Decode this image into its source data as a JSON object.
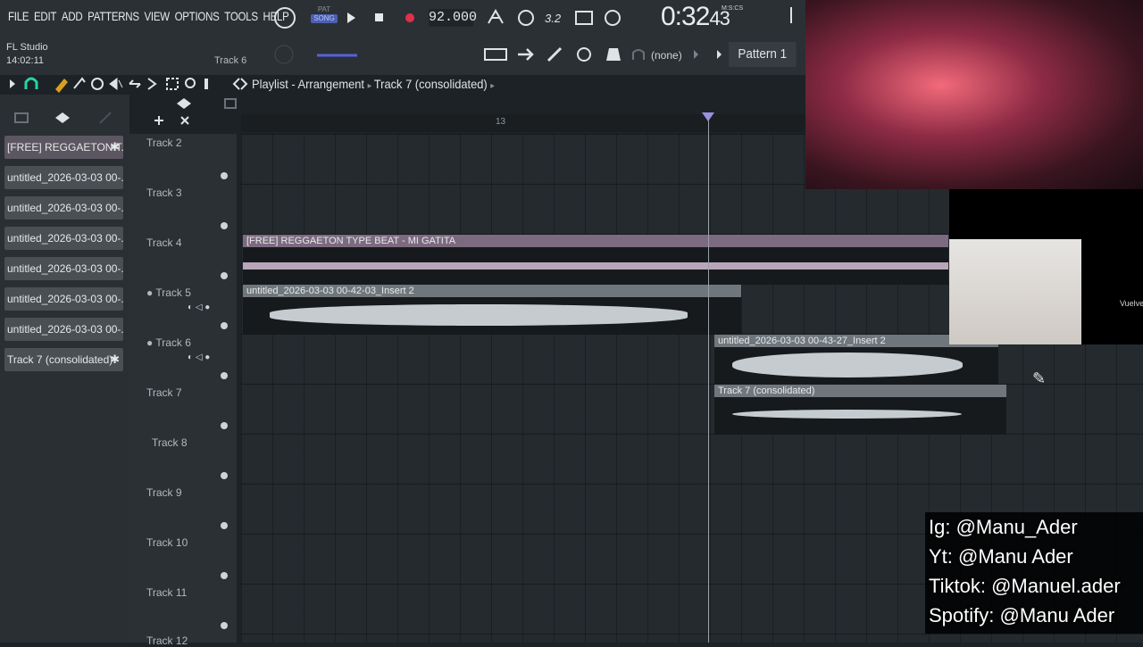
{
  "menu": [
    "FILE",
    "EDIT",
    "ADD",
    "PATTERNS",
    "VIEW",
    "OPTIONS",
    "TOOLS",
    "HELP"
  ],
  "app": {
    "name": "FL Studio",
    "time": "14:02:11",
    "hint_track": "Track 6"
  },
  "transport": {
    "pat_label": "PAT",
    "song_label": "SONG",
    "tempo": "92.000",
    "time_main": "0:32",
    "time_sub": "43",
    "time_label": "M:S:CS"
  },
  "toolbar": {
    "channel_none": "(none)",
    "pattern": "Pattern 1"
  },
  "playlist": {
    "title": "Playlist - Arrangement",
    "crumb": "Track 7 (consolidated)",
    "bar_marker": "13"
  },
  "browser": {
    "items": [
      {
        "label": "[FREE] REGGAETON T...",
        "active": true
      },
      {
        "label": "untitled_2026-03-03 00-...",
        "active": false
      },
      {
        "label": "untitled_2026-03-03 00-...",
        "active": false
      },
      {
        "label": "untitled_2026-03-03 00-...",
        "active": false
      },
      {
        "label": "untitled_2026-03-03 00-...",
        "active": false
      },
      {
        "label": "untitled_2026-03-03 00-...",
        "active": false
      },
      {
        "label": "untitled_2026-03-03 00-...",
        "active": false
      },
      {
        "label": "Track 7 (consolidated)",
        "active": false
      }
    ]
  },
  "tracks": [
    "Track 2",
    "Track 3",
    "Track 4",
    "Track 5",
    "Track 6",
    "Track 7",
    "Track 8",
    "Track 9",
    "Track 10",
    "Track 11",
    "Track 12"
  ],
  "clips": [
    {
      "label": "[FREE] REGGAETON TYPE BEAT - MI GATITA",
      "color": "#7c6a80"
    },
    {
      "label": "untitled_2026-03-03 00-42-03_Insert 2",
      "color": "#6f777c"
    },
    {
      "label": "untitled_2026-03-03 00-43-27_Insert 2",
      "color": "#6f777c"
    },
    {
      "label": "Track 7 (consolidated)",
      "color": "#6f777c"
    }
  ],
  "overlay": {
    "vuelve": "Vuelve",
    "social": [
      "Ig: @Manu_Ader",
      "Yt: @Manu Ader",
      "Tiktok: @Manuel.ader",
      "Spotify: @Manu Ader"
    ]
  },
  "icons": [
    "play-icon",
    "stop-icon",
    "record-icon",
    "magnet-icon",
    "pencil-icon",
    "brush-icon",
    "zoom-icon",
    "pen-cursor-icon"
  ]
}
